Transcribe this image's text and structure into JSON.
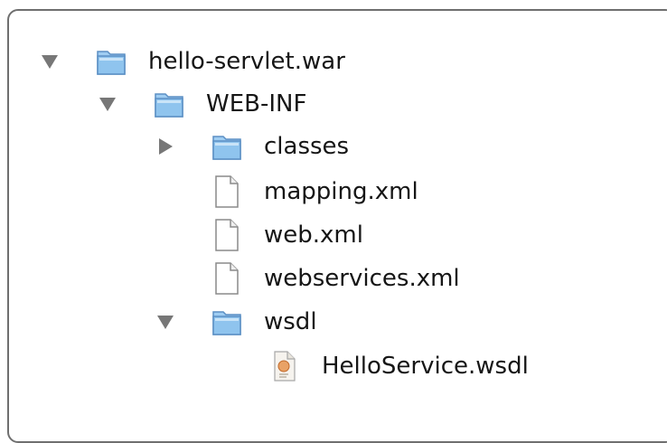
{
  "tree": {
    "items": [
      {
        "label": "hello-servlet.war",
        "type": "folder",
        "expander": "expanded"
      },
      {
        "label": "WEB-INF",
        "type": "folder",
        "expander": "expanded"
      },
      {
        "label": "classes",
        "type": "folder",
        "expander": "collapsed"
      },
      {
        "label": "mapping.xml",
        "type": "file",
        "expander": "none"
      },
      {
        "label": "web.xml",
        "type": "file",
        "expander": "none"
      },
      {
        "label": "webservices.xml",
        "type": "file",
        "expander": "none"
      },
      {
        "label": "wsdl",
        "type": "folder",
        "expander": "expanded"
      },
      {
        "label": "HelloService.wsdl",
        "type": "wsdl-file",
        "expander": "none"
      }
    ]
  },
  "icons": {
    "expanded": "disclosure-down-icon",
    "collapsed": "disclosure-right-icon",
    "folder": "folder-icon",
    "file": "document-icon",
    "wsdl-file": "wsdl-document-icon"
  },
  "colors": {
    "folder_fill": "#8fc4ee",
    "folder_stroke": "#5b8fc4",
    "disclosure": "#777777",
    "panel_border": "#6f6f6f"
  }
}
